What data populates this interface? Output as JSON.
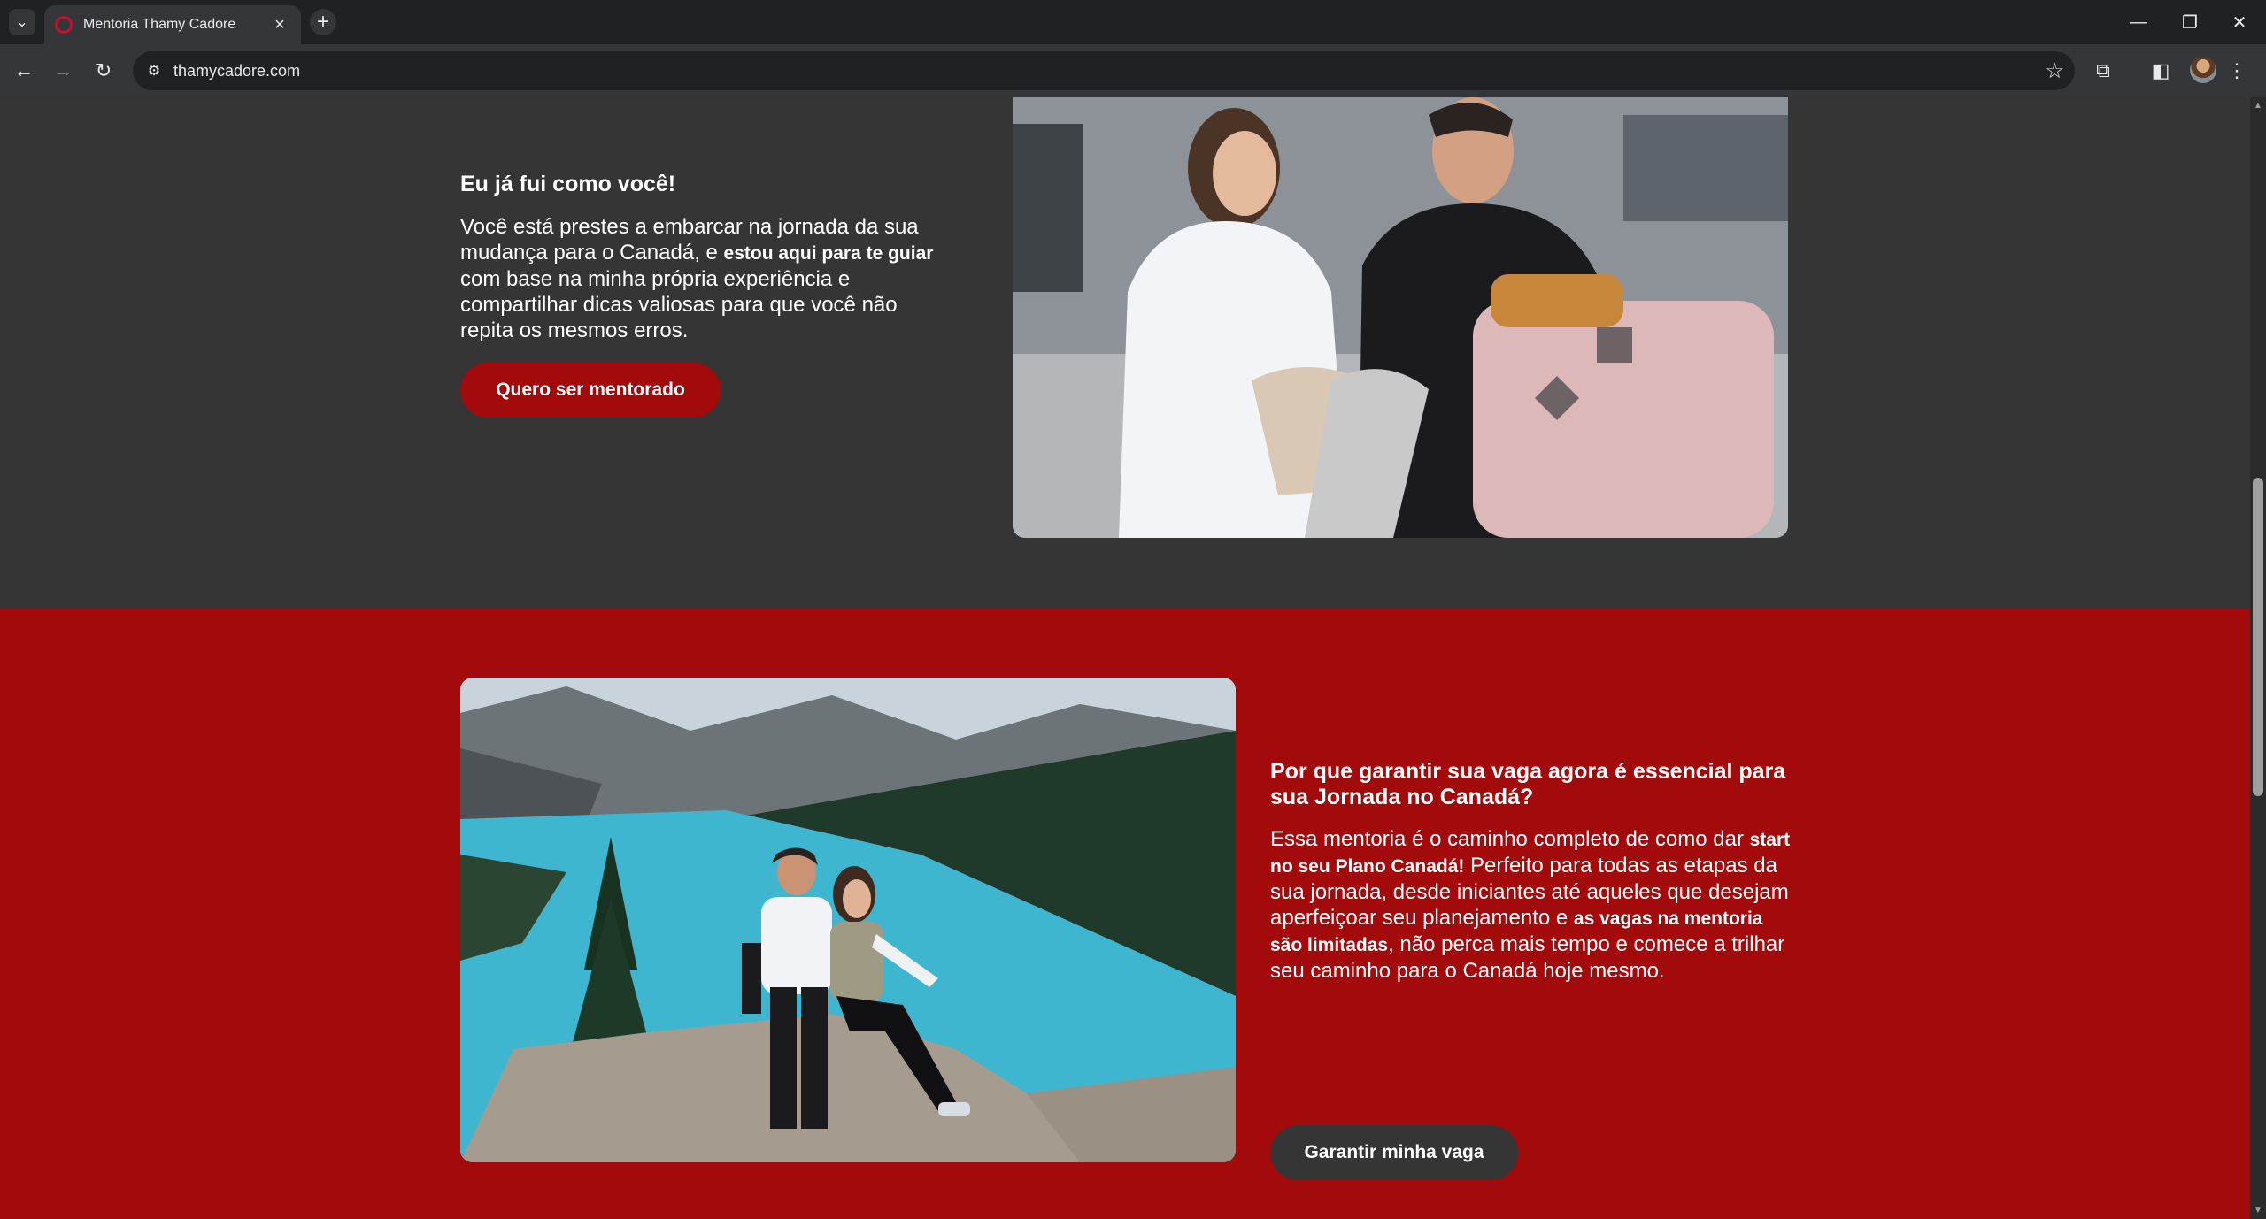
{
  "browser": {
    "tab_title": "Mentoria Thamy Cadore",
    "url": "thamycadore.com",
    "win_minimize": "—",
    "win_restore": "❐",
    "win_close": "✕"
  },
  "section_about": {
    "heading": "Eu já fui como você!",
    "body_1": "Você está prestes a embarcar na jornada da sua mudança para o Canadá, e ",
    "body_bold": "estou aqui para te guiar",
    "body_2": " com base na minha própria experiência e compartilhar dicas valiosas para que você não repita os mesmos erros.",
    "cta_label": "Quero ser mentorado",
    "cta_color": "#a20a0c"
  },
  "section_why": {
    "heading": "Por que garantir sua vaga agora é essencial para sua Jornada no Canadá?",
    "body_1": "Essa mentoria é o caminho completo de como dar ",
    "body_bold_1": "start no seu Plano Canadá!",
    "body_2": " Perfeito para todas as etapas da sua jornada, desde iniciantes até aqueles que desejam aperfeiçoar seu planejamento e ",
    "body_bold_2": "as vagas na mentoria são limitadas",
    "body_3": ", não perca mais tempo e comece a trilhar seu caminho para o Canadá hoje mesmo.",
    "cta_label": "Garantir minha vaga",
    "cta_color": "#353535"
  },
  "colors": {
    "dark_section": "#353535",
    "red_section": "#a20a0c"
  }
}
